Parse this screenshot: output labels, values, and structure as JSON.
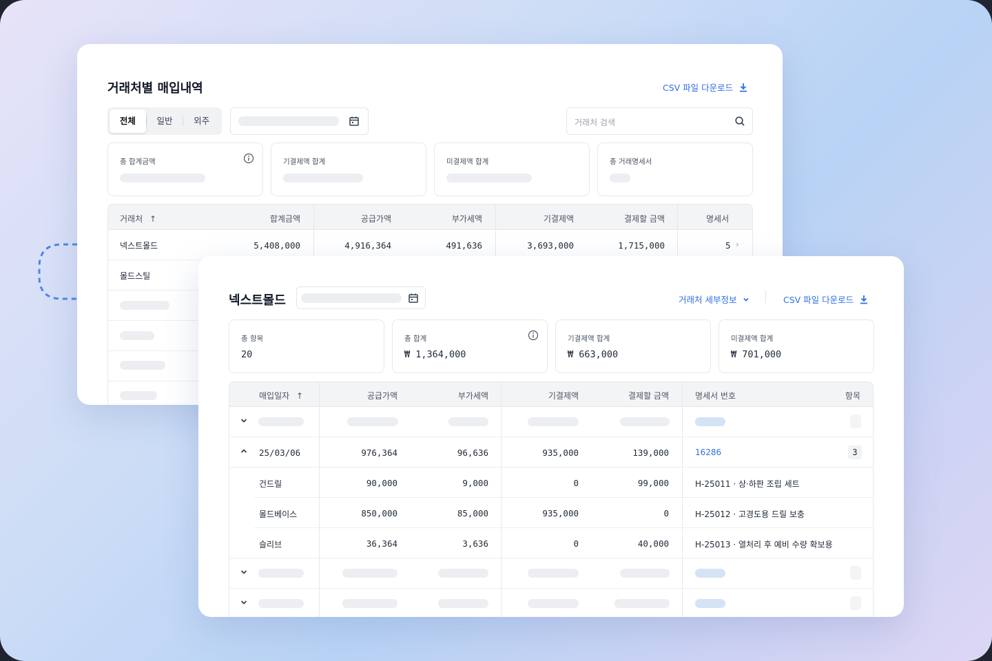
{
  "colors": {
    "accent": "#2f6fe0",
    "connector": "#4a86e8"
  },
  "back_panel": {
    "title": "거래처별 매입내역",
    "csv_link": "CSV 파일 다운로드",
    "tabs": [
      "전체",
      "일반",
      "외주"
    ],
    "active_tab": "전체",
    "search_placeholder": "거래처 검색",
    "stats": [
      {
        "label": "총 합계금액"
      },
      {
        "label": "기결제액 합계"
      },
      {
        "label": "미결제액 합계"
      },
      {
        "label": "총 거래명세서"
      }
    ],
    "table": {
      "headers": [
        "거래처",
        "합계금액",
        "공급가액",
        "부가세액",
        "기결제액",
        "결제할 금액",
        "명세서"
      ],
      "sort_icon": "arrow-up-icon",
      "rows": [
        {
          "vendor": "넥스트몰드",
          "total": "5,408,000",
          "supply": "4,916,364",
          "vat": "491,636",
          "paid": "3,693,000",
          "due": "1,715,000",
          "count": "5"
        },
        {
          "vendor": "몰드스틸"
        }
      ]
    }
  },
  "front_panel": {
    "title": "넥스트몰드",
    "detail_link": "거래처 세부정보",
    "csv_link": "CSV 파일 다운로드",
    "stats": [
      {
        "label": "총 항목",
        "value": "20"
      },
      {
        "label": "총 합계",
        "value": "₩ 1,364,000"
      },
      {
        "label": "기결제액 합계",
        "value": "₩ 663,000"
      },
      {
        "label": "미결제액 합계",
        "value": "₩ 701,000"
      }
    ],
    "table": {
      "headers": [
        "매입일자",
        "공급가액",
        "부가세액",
        "기결제액",
        "결제할 금액",
        "명세서 번호",
        "항목"
      ],
      "expanded_row": {
        "date": "25/03/06",
        "supply": "976,364",
        "vat": "96,636",
        "paid": "935,000",
        "due": "139,000",
        "invoice": "16286",
        "items": "3"
      },
      "sub_rows": [
        {
          "name": "건드릴",
          "supply": "90,000",
          "vat": "9,000",
          "paid": "0",
          "due": "99,000",
          "invoice_desc": "H-25011 · 상·하판 조립 세트"
        },
        {
          "name": "몰드베이스",
          "supply": "850,000",
          "vat": "85,000",
          "paid": "935,000",
          "due": "0",
          "invoice_desc": "H-25012 · 고경도용 드릴 보충"
        },
        {
          "name": "슬리브",
          "supply": "36,364",
          "vat": "3,636",
          "paid": "0",
          "due": "40,000",
          "invoice_desc": "H-25013 · 열처리 후 예비 수량 확보용"
        }
      ]
    }
  }
}
